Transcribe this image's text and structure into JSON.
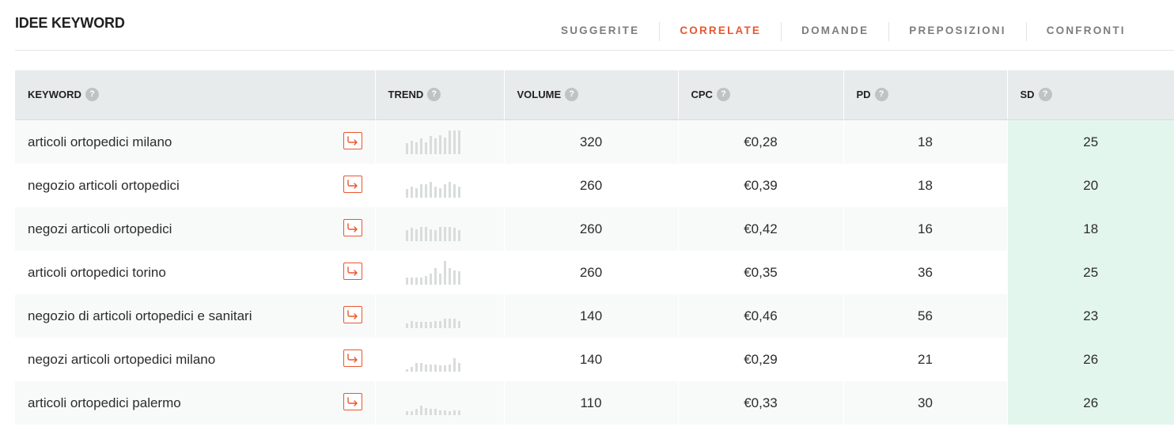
{
  "header": {
    "title": "IDEE KEYWORD"
  },
  "tabs": [
    {
      "label": "SUGGERITE",
      "active": false
    },
    {
      "label": "CORRELATE",
      "active": true
    },
    {
      "label": "DOMANDE",
      "active": false
    },
    {
      "label": "PREPOSIZIONI",
      "active": false
    },
    {
      "label": "CONFRONTI",
      "active": false
    }
  ],
  "colors": {
    "accent": "#e8572e",
    "header_bg": "#e8ebeb",
    "sd_bg": "#e3f6ee",
    "trend_bar": "#d9dcdc"
  },
  "table": {
    "columns": [
      {
        "label": "KEYWORD",
        "help": "?"
      },
      {
        "label": "TREND",
        "help": "?"
      },
      {
        "label": "VOLUME",
        "help": "?"
      },
      {
        "label": "CPC",
        "help": "?"
      },
      {
        "label": "PD",
        "help": "?"
      },
      {
        "label": "SD",
        "help": "?"
      }
    ],
    "rows": [
      {
        "keyword": "articoli ortopedici milano",
        "volume": "320",
        "cpc": "€0,28",
        "pd": "18",
        "sd": "25",
        "trend": [
          0.45,
          0.55,
          0.5,
          0.65,
          0.5,
          0.75,
          0.65,
          0.8,
          0.7,
          1.0,
          1.0,
          1.0
        ]
      },
      {
        "keyword": "negozio articoli ortopedici",
        "volume": "260",
        "cpc": "€0,39",
        "pd": "18",
        "sd": "20",
        "trend": [
          0.35,
          0.45,
          0.4,
          0.55,
          0.55,
          0.65,
          0.45,
          0.4,
          0.55,
          0.65,
          0.55,
          0.45
        ]
      },
      {
        "keyword": "negozi articoli ortopedici",
        "volume": "260",
        "cpc": "€0,42",
        "pd": "16",
        "sd": "18",
        "trend": [
          0.45,
          0.55,
          0.5,
          0.6,
          0.6,
          0.5,
          0.45,
          0.6,
          0.6,
          0.6,
          0.55,
          0.45
        ]
      },
      {
        "keyword": "articoli ortopedici torino",
        "volume": "260",
        "cpc": "€0,35",
        "pd": "36",
        "sd": "25",
        "trend": [
          0.3,
          0.3,
          0.3,
          0.3,
          0.35,
          0.45,
          0.7,
          0.45,
          1.0,
          0.7,
          0.6,
          0.55
        ]
      },
      {
        "keyword": "negozio di articoli ortopedici e sanitari",
        "volume": "140",
        "cpc": "€0,46",
        "pd": "56",
        "sd": "23",
        "trend": [
          0.2,
          0.3,
          0.25,
          0.25,
          0.25,
          0.25,
          0.3,
          0.3,
          0.4,
          0.4,
          0.4,
          0.3
        ]
      },
      {
        "keyword": "negozi articoli ortopedici milano",
        "volume": "140",
        "cpc": "€0,29",
        "pd": "21",
        "sd": "26",
        "trend": [
          0.1,
          0.2,
          0.35,
          0.35,
          0.3,
          0.3,
          0.3,
          0.25,
          0.25,
          0.3,
          0.55,
          0.35
        ]
      },
      {
        "keyword": "articoli ortopedici palermo",
        "volume": "110",
        "cpc": "€0,33",
        "pd": "30",
        "sd": "26",
        "trend": [
          0.15,
          0.15,
          0.25,
          0.4,
          0.3,
          0.25,
          0.25,
          0.2,
          0.2,
          0.15,
          0.2,
          0.2
        ]
      }
    ]
  }
}
